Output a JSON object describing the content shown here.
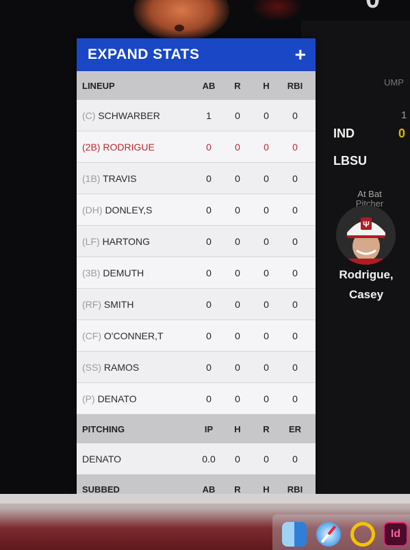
{
  "top": {
    "score_fragment": "0"
  },
  "panel": {
    "title": "EXPAND STATS",
    "lineup": {
      "header": [
        "LINEUP",
        "AB",
        "R",
        "H",
        "RBI"
      ],
      "rows": [
        {
          "pos": "(C)",
          "name": "SCHWARBER",
          "vals": [
            "1",
            "0",
            "0",
            "0"
          ],
          "highlight": false
        },
        {
          "pos": "(2B)",
          "name": "RODRIGUE",
          "vals": [
            "0",
            "0",
            "0",
            "0"
          ],
          "highlight": true
        },
        {
          "pos": "(1B)",
          "name": "TRAVIS",
          "vals": [
            "0",
            "0",
            "0",
            "0"
          ],
          "highlight": false
        },
        {
          "pos": "(DH)",
          "name": "DONLEY,S",
          "vals": [
            "0",
            "0",
            "0",
            "0"
          ],
          "highlight": false
        },
        {
          "pos": "(LF)",
          "name": "HARTONG",
          "vals": [
            "0",
            "0",
            "0",
            "0"
          ],
          "highlight": false
        },
        {
          "pos": "(3B)",
          "name": "DEMUTH",
          "vals": [
            "0",
            "0",
            "0",
            "0"
          ],
          "highlight": false
        },
        {
          "pos": "(RF)",
          "name": "SMITH",
          "vals": [
            "0",
            "0",
            "0",
            "0"
          ],
          "highlight": false
        },
        {
          "pos": "(CF)",
          "name": "O'CONNER,T",
          "vals": [
            "0",
            "0",
            "0",
            "0"
          ],
          "highlight": false
        },
        {
          "pos": "(SS)",
          "name": "RAMOS",
          "vals": [
            "0",
            "0",
            "0",
            "0"
          ],
          "highlight": false
        },
        {
          "pos": "(P)",
          "name": "DENATO",
          "vals": [
            "0",
            "0",
            "0",
            "0"
          ],
          "highlight": false
        }
      ]
    },
    "pitching": {
      "header": [
        "PITCHING",
        "IP",
        "H",
        "R",
        "ER"
      ],
      "rows": [
        {
          "name": "DENATO",
          "vals": [
            "0.0",
            "0",
            "0",
            "0"
          ]
        }
      ]
    },
    "subbed": {
      "header": [
        "SUBBED",
        "AB",
        "R",
        "H",
        "RBI"
      ]
    }
  },
  "right": {
    "ump_label": "UMP",
    "inning_fragment": "1",
    "team1": "IND",
    "team1_score": "0",
    "team2": "LBSU",
    "at_bat_label": "At Bat",
    "pitcher_label": "Pitcher",
    "player_name_line1": "Rodrigue,",
    "player_name_line2": "Casey"
  },
  "dock": {
    "id_label": "Id"
  },
  "colors": {
    "header_blue": "#1a47c6",
    "highlight_red": "#c0262c",
    "score_yellow": "#e0b400"
  }
}
